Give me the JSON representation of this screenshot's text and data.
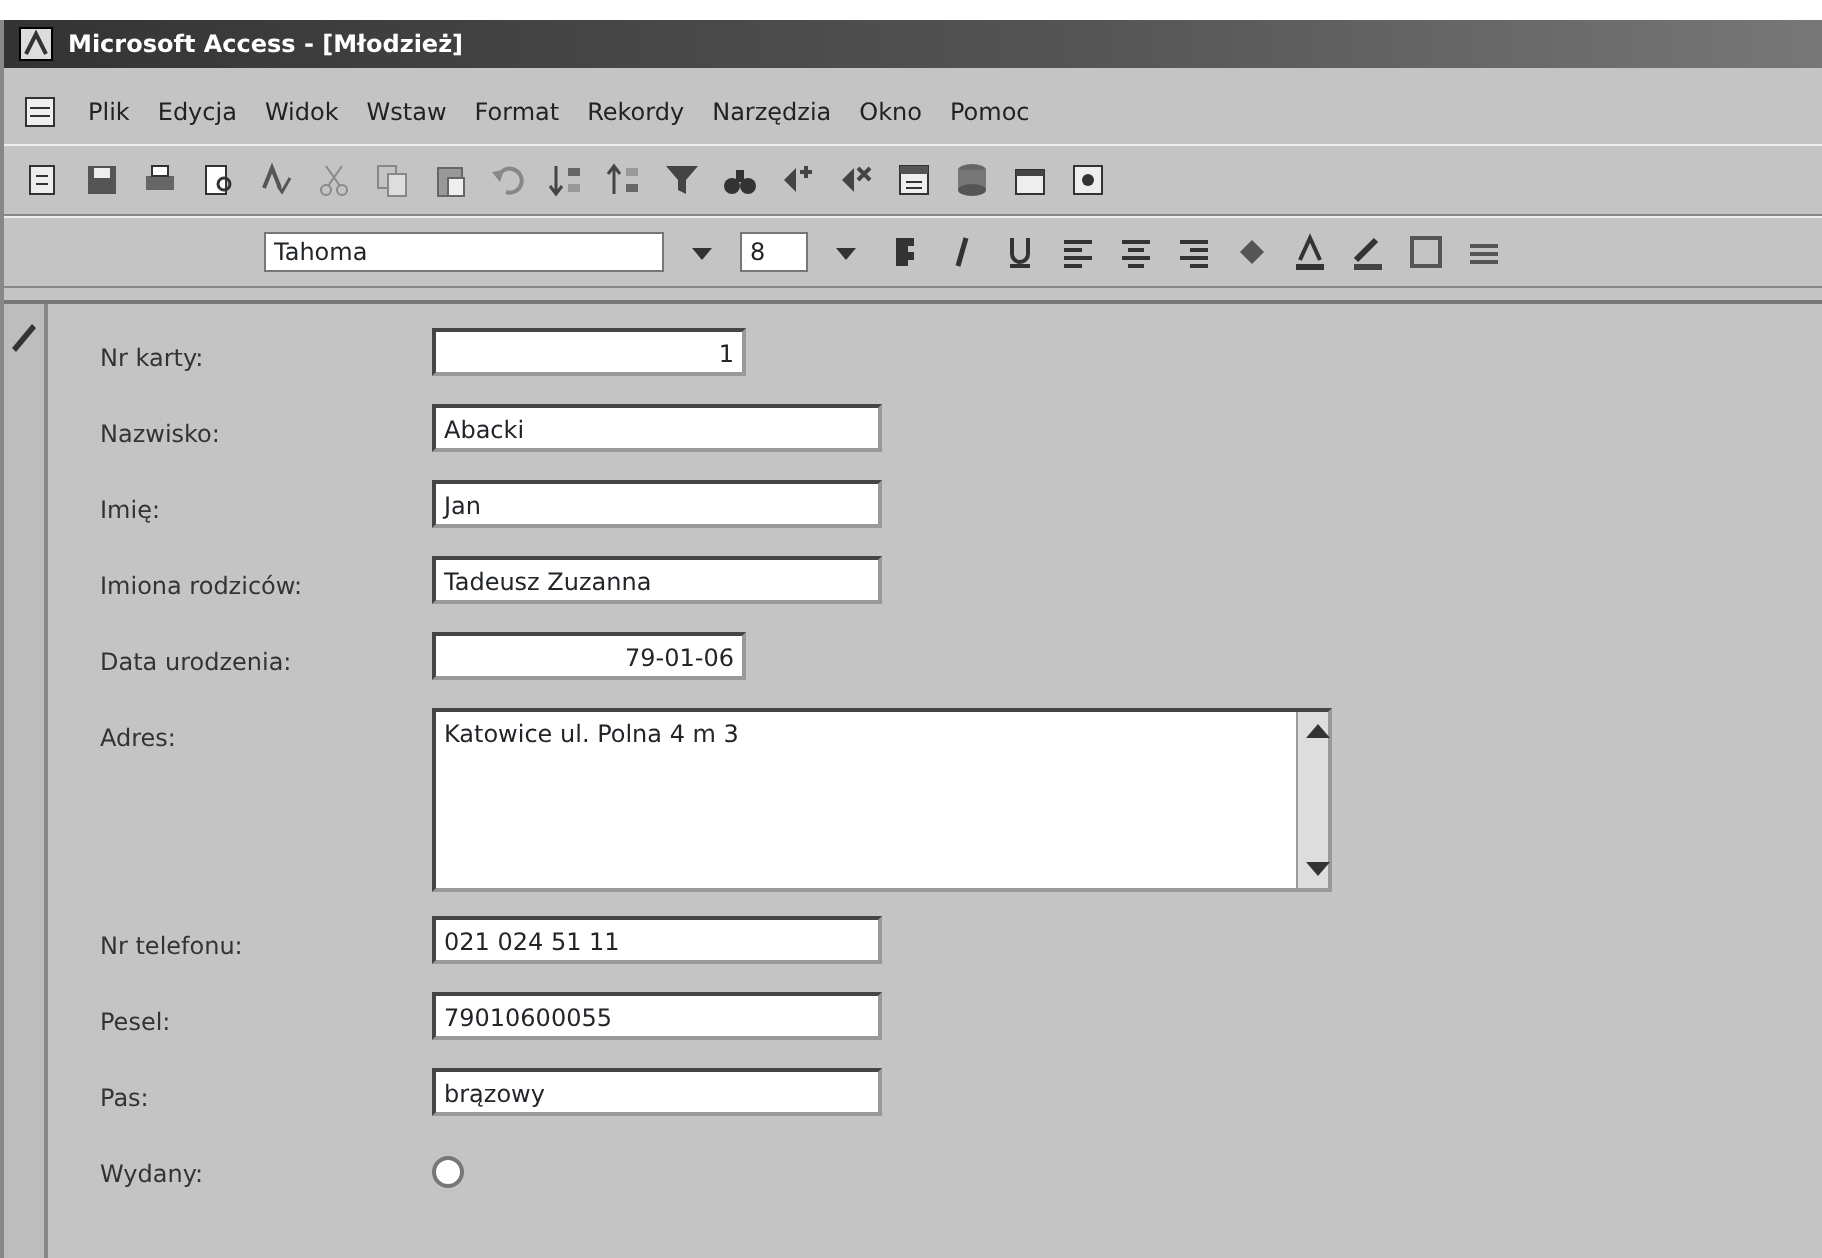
{
  "window": {
    "title": "Microsoft Access - [Młodzież]"
  },
  "menu": [
    "Plik",
    "Edycja",
    "Widok",
    "Wstaw",
    "Format",
    "Rekordy",
    "Narzędzia",
    "Okno",
    "Pomoc"
  ],
  "format_toolbar": {
    "font": "Tahoma",
    "size": "8"
  },
  "form": {
    "fields": [
      {
        "kind": "number",
        "label": "Nr karty:",
        "value": "1"
      },
      {
        "kind": "text",
        "label": "Nazwisko:",
        "value": "Abacki"
      },
      {
        "kind": "text",
        "label": "Imię:",
        "value": "Jan"
      },
      {
        "kind": "text",
        "label": "Imiona rodziców:",
        "value": "Tadeusz Zuzanna"
      },
      {
        "kind": "number",
        "label": "Data urodzenia:",
        "value": "79-01-06"
      },
      {
        "kind": "memo",
        "label": "Adres:",
        "value": "Katowice ul. Polna 4 m 3"
      },
      {
        "kind": "text",
        "label": "Nr telefonu:",
        "value": "021 024 51 11"
      },
      {
        "kind": "text",
        "label": "Pesel:",
        "value": "79010600055"
      },
      {
        "kind": "text",
        "label": "Pas:",
        "value": "brązowy"
      },
      {
        "kind": "check",
        "label": "Wydany:",
        "checked": false
      }
    ]
  }
}
